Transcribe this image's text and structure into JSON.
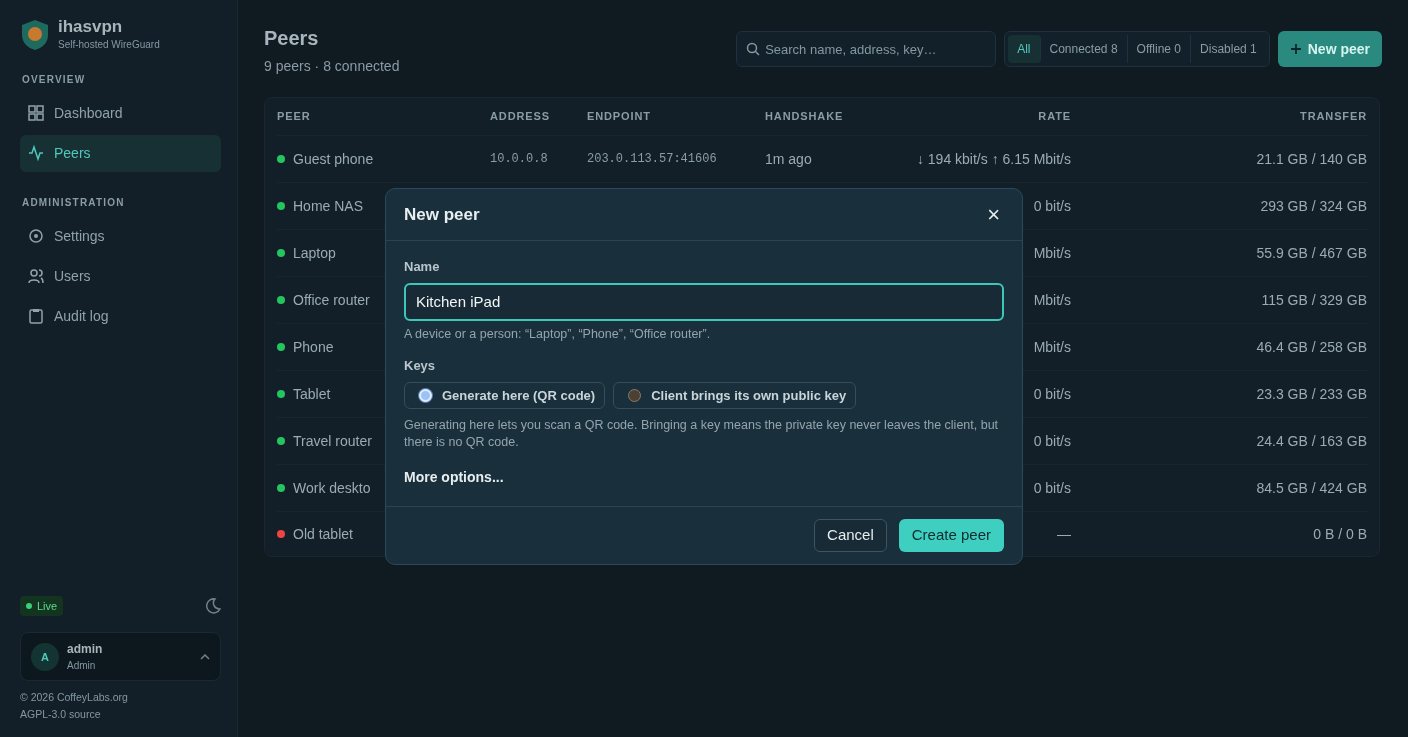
{
  "sidebar": {
    "brand": {
      "name": "ihasvpn",
      "tagline": "Self-hosted WireGuard"
    },
    "sections": [
      {
        "heading": "OVERVIEW",
        "items": [
          {
            "label": "Dashboard",
            "selected": false
          },
          {
            "label": "Peers",
            "selected": true
          }
        ]
      },
      {
        "heading": "ADMINISTRATION",
        "items": [
          {
            "label": "Settings",
            "selected": false
          },
          {
            "label": "Users",
            "selected": false
          },
          {
            "label": "Audit log",
            "selected": false
          }
        ]
      }
    ],
    "live_badge": "Live",
    "user": {
      "avatar": "A",
      "name": "admin",
      "role": "Admin"
    },
    "footer": [
      "© 2026 CoffeyLabs.org",
      "AGPL-3.0 source"
    ]
  },
  "header": {
    "title": "Peers",
    "subtitle": "9 peers · 8 connected",
    "search": {
      "placeholder": "Search name, address, key…"
    },
    "filters": [
      {
        "label": "All",
        "selected": true
      },
      {
        "label": "Connected 8",
        "selected": false
      },
      {
        "label": "Offline 0",
        "selected": false
      },
      {
        "label": "Disabled 1",
        "selected": false
      }
    ],
    "new_button": "New peer"
  },
  "table": {
    "columns": [
      "PEER",
      "ADDRESS",
      "ENDPOINT",
      "HANDSHAKE",
      "RATE",
      "TRANSFER"
    ],
    "rows": [
      {
        "peer": "Guest phone",
        "color": "#22c55e",
        "address": "10.0.0.8",
        "endpoint": "203.0.113.57:41606",
        "handshake": "1m ago",
        "rate": "↓ 194 kbit/s ↑ 6.15 Mbit/s",
        "transfer": "21.1 GB / 140 GB"
      },
      {
        "peer": "Home NAS",
        "color": "#22c55e",
        "rate": "0 bit/s",
        "transfer": "293 GB / 324 GB"
      },
      {
        "peer": "Laptop",
        "color": "#22c55e",
        "rate": "Mbit/s",
        "transfer": "55.9 GB / 467 GB"
      },
      {
        "peer": "Office router",
        "color": "#22c55e",
        "rate": "Mbit/s",
        "transfer": "115 GB / 329 GB"
      },
      {
        "peer": "Phone",
        "color": "#22c55e",
        "rate": "Mbit/s",
        "transfer": "46.4 GB / 258 GB"
      },
      {
        "peer": "Tablet",
        "color": "#22c55e",
        "rate": "0 bit/s",
        "transfer": "23.3 GB / 233 GB"
      },
      {
        "peer": "Travel router",
        "color": "#22c55e",
        "rate": "0 bit/s",
        "transfer": "24.4 GB / 163 GB"
      },
      {
        "peer": "Work deskto",
        "color": "#22c55e",
        "rate": "0 bit/s",
        "transfer": "84.5 GB / 424 GB"
      },
      {
        "peer": "Old tablet",
        "color": "#ef4444",
        "rate": "—",
        "transfer": "0 B / 0 B"
      }
    ]
  },
  "dialog": {
    "title": "New peer",
    "close": "×",
    "name_field": {
      "label": "Name",
      "value": "Kitchen iPad",
      "help": "A device or a person: “Laptop”, “Phone”, “Office router”."
    },
    "keys": {
      "label": "Keys",
      "options": [
        {
          "label": "Generate here (QR code)",
          "selected": true
        },
        {
          "label": "Client brings its own public key",
          "selected": false
        }
      ],
      "help": "Generating here lets you scan a QR code. Bringing a key means the private key never leaves the client, but there is no QR code."
    },
    "more_options": "More options...",
    "buttons": [
      {
        "label": "Cancel",
        "kind": "secondary"
      },
      {
        "label": "Create peer",
        "kind": "primary"
      }
    ]
  }
}
